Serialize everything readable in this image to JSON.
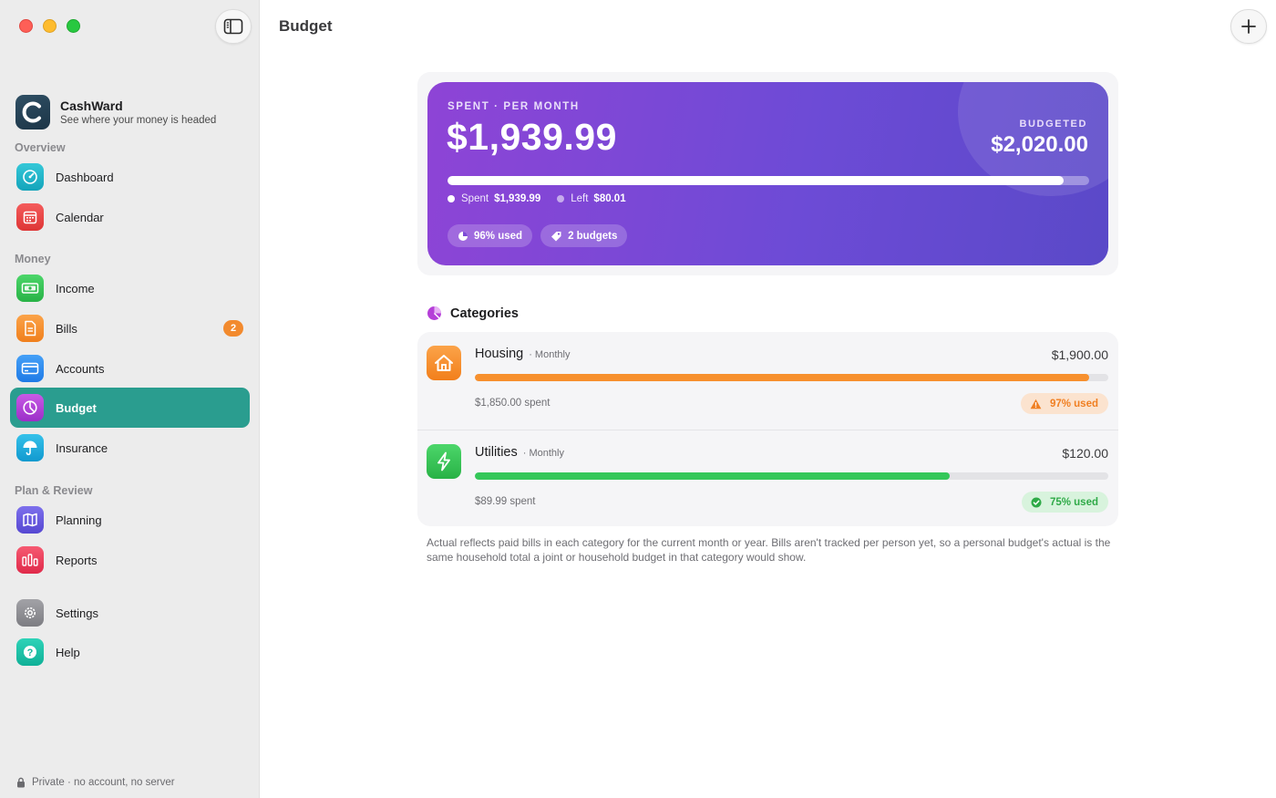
{
  "window": {
    "title": "Budget"
  },
  "brand": {
    "name": "CashWard",
    "tagline": "See where your money is headed"
  },
  "sidebar": {
    "sections": {
      "overview": "Overview",
      "money": "Money",
      "plan": "Plan & Review"
    },
    "items": {
      "dashboard": {
        "label": "Dashboard",
        "icon": "gauge-icon",
        "color": "#1fb6c9"
      },
      "calendar": {
        "label": "Calendar",
        "icon": "calendar-icon",
        "color": "#ee4a4a"
      },
      "income": {
        "label": "Income",
        "icon": "banknote-icon",
        "color": "#34c759"
      },
      "bills": {
        "label": "Bills",
        "icon": "document-icon",
        "color": "#f7902e",
        "badge": "2"
      },
      "accounts": {
        "label": "Accounts",
        "icon": "credit-card-icon",
        "color": "#2f8cf0"
      },
      "budget": {
        "label": "Budget",
        "icon": "pie-chart-icon",
        "color": "#b33fd8",
        "active": true
      },
      "insurance": {
        "label": "Insurance",
        "icon": "umbrella-icon",
        "color": "#1aaede"
      },
      "planning": {
        "label": "Planning",
        "icon": "map-icon",
        "color": "#6a5de0"
      },
      "reports": {
        "label": "Reports",
        "icon": "bar-chart-icon",
        "color": "#f0405e"
      },
      "settings": {
        "label": "Settings",
        "icon": "gear-icon",
        "color": "#8e8e93"
      },
      "help": {
        "label": "Help",
        "icon": "question-icon",
        "color": "#18c1a8"
      }
    },
    "footer": "Private · no account, no server"
  },
  "summary": {
    "eyebrow": "SPENT · PER MONTH",
    "spent": "$1,939.99",
    "budgeted_label": "BUDGETED",
    "budgeted": "$2,020.00",
    "progress": 0.96,
    "legend_spent_label": "Spent",
    "legend_spent_value": "$1,939.99",
    "legend_left_label": "Left",
    "legend_left_value": "$80.01",
    "chip_used": "96% used",
    "chip_budgets": "2 budgets"
  },
  "categories": {
    "header": "Categories",
    "items": [
      {
        "name": "Housing",
        "period": "· Monthly",
        "budget": "$1,900.00",
        "spent": "$1,850.00 spent",
        "used": "97% used",
        "progress": 0.97,
        "color": "#f7902e",
        "icon": "house-icon",
        "status": "warning"
      },
      {
        "name": "Utilities",
        "period": "· Monthly",
        "budget": "$120.00",
        "spent": "$89.99 spent",
        "used": "75% used",
        "progress": 0.75,
        "color": "#34c759",
        "icon": "bolt-icon",
        "status": "ok"
      }
    ]
  },
  "footnote": "Actual reflects paid bills in each category for the current month or year. Bills aren't tracked per person yet, so a personal budget's actual is the same household total a joint or household budget in that category would show."
}
